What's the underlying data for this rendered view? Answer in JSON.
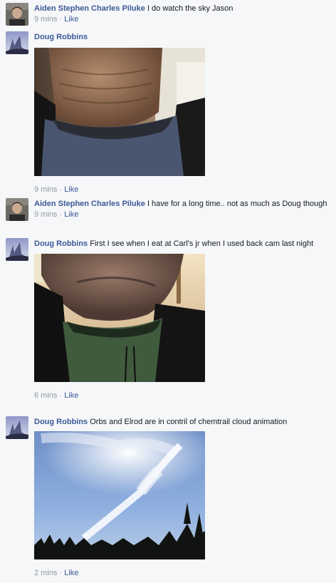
{
  "comments": [
    {
      "author": "Aiden Stephen Charles Piluke",
      "text": "I do watch the sky Jason",
      "time": "9 mins",
      "separator": "·",
      "like": "Like",
      "avatar_icon": "profile-photo-young-man"
    },
    {
      "author": "Doug Robbins",
      "text": "",
      "time": "9 mins",
      "separator": "·",
      "like": "Like",
      "avatar_icon": "profile-photo-sky",
      "photo": "photo-neck-closeup"
    },
    {
      "author": "Aiden Stephen Charles Piluke",
      "text": "I have for a long time.. not as much as Doug though",
      "time": "9 mins",
      "separator": "·",
      "like": "Like",
      "avatar_icon": "profile-photo-young-man"
    },
    {
      "author": "Doug Robbins",
      "text": "First I see when I eat at Carl's jr when I used back cam last night",
      "time": "6 mins",
      "separator": "·",
      "like": "Like",
      "avatar_icon": "profile-photo-sky",
      "photo": "photo-chin-restaurant"
    },
    {
      "author": "Doug Robbins",
      "text": "Orbs and Elrod are in contril of chemtrail cloud animation",
      "time": "2 mins",
      "separator": "·",
      "like": "Like",
      "avatar_icon": "profile-photo-sky",
      "photo": "photo-sky-chemtrail"
    }
  ],
  "colors": {
    "background": "#f6f7f9",
    "author_link": "#3b5998",
    "meta_text": "#9197a3",
    "body_text": "#141823"
  }
}
